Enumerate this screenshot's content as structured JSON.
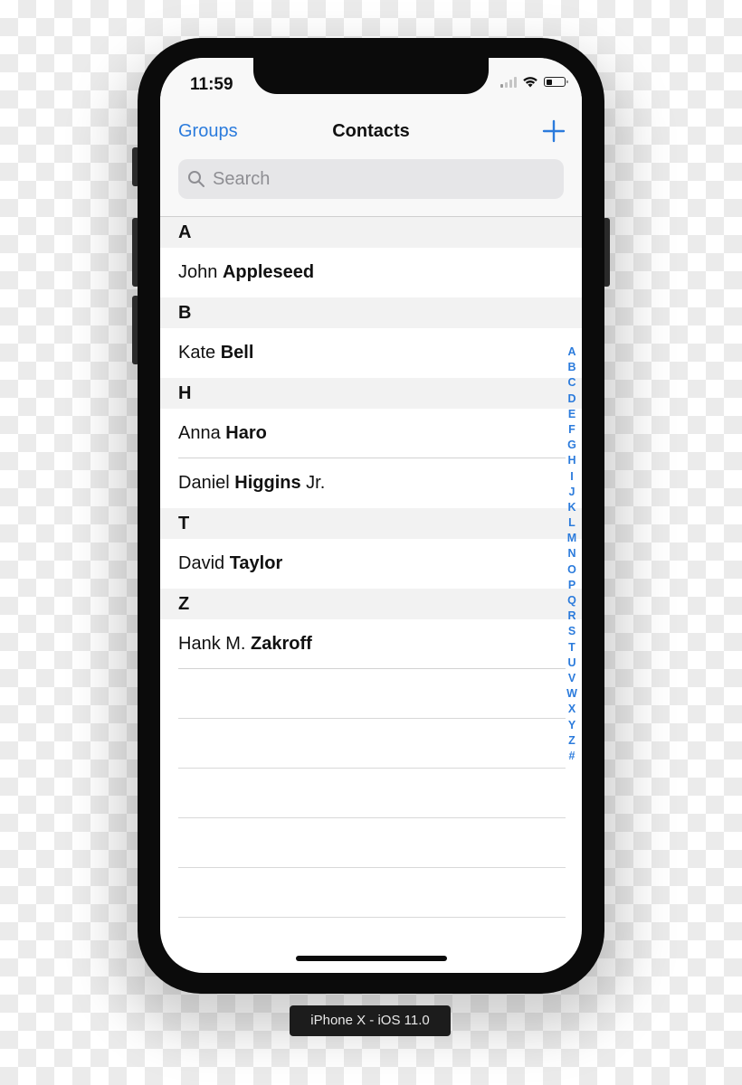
{
  "status_bar": {
    "time": "11:59",
    "signal_bars_active": 1,
    "signal_bars_total": 4,
    "wifi": true,
    "battery_level": 0.3
  },
  "nav": {
    "left_button": "Groups",
    "title": "Contacts",
    "add_button_icon": "plus-icon"
  },
  "search": {
    "placeholder": "Search",
    "value": ""
  },
  "sections": [
    {
      "letter": "A",
      "contacts": [
        {
          "first": "John",
          "last": "Appleseed",
          "suffix": ""
        }
      ]
    },
    {
      "letter": "B",
      "contacts": [
        {
          "first": "Kate",
          "last": "Bell",
          "suffix": ""
        }
      ]
    },
    {
      "letter": "H",
      "contacts": [
        {
          "first": "Anna",
          "last": "Haro",
          "suffix": ""
        },
        {
          "first": "Daniel",
          "last": "Higgins",
          "suffix": "Jr."
        }
      ]
    },
    {
      "letter": "T",
      "contacts": [
        {
          "first": "David",
          "last": "Taylor",
          "suffix": ""
        }
      ]
    },
    {
      "letter": "Z",
      "contacts": [
        {
          "first": "Hank M.",
          "last": "Zakroff",
          "suffix": ""
        }
      ]
    }
  ],
  "section_index": [
    "A",
    "B",
    "C",
    "D",
    "E",
    "F",
    "G",
    "H",
    "I",
    "J",
    "K",
    "L",
    "M",
    "N",
    "O",
    "P",
    "Q",
    "R",
    "S",
    "T",
    "U",
    "V",
    "W",
    "X",
    "Y",
    "Z",
    "#"
  ],
  "device_label": "iPhone X - iOS 11.0",
  "colors": {
    "accent": "#2b7bdc",
    "section_header_bg": "#f2f2f2",
    "nav_bg": "#f8f8f8",
    "search_bg": "#e6e6e8"
  }
}
